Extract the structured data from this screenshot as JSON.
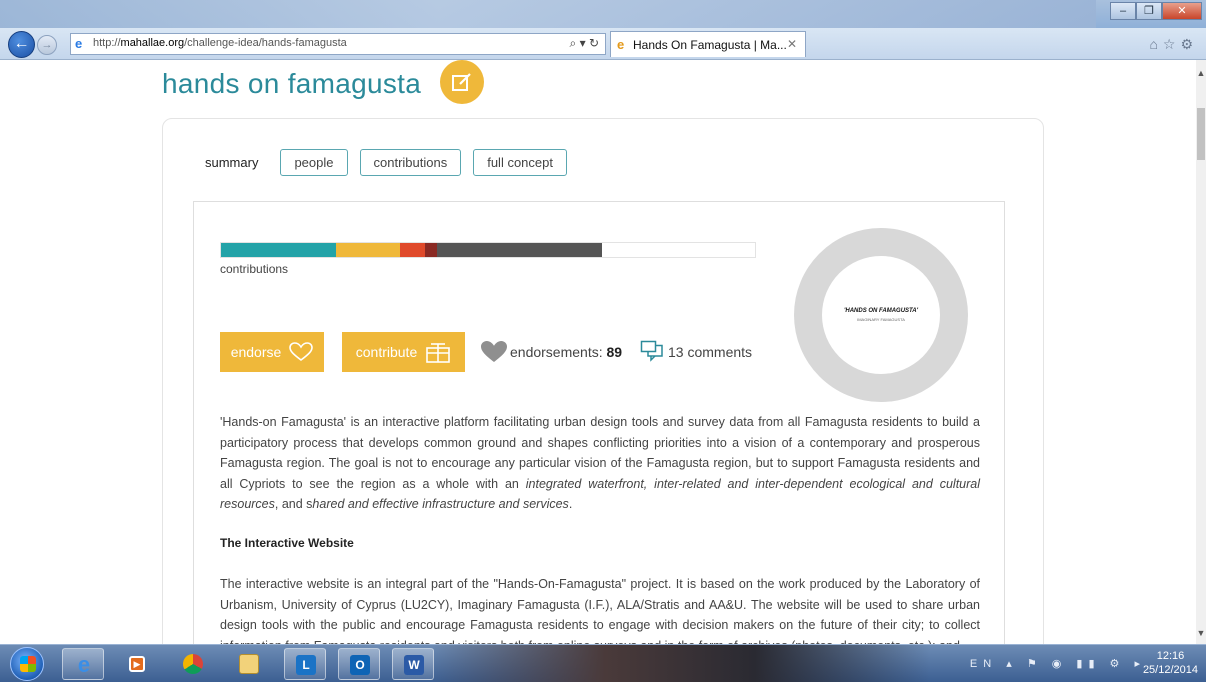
{
  "browser": {
    "url_prefix": "http://",
    "url_host": "mahallae.org",
    "url_path": "/challenge-idea/hands-famagusta",
    "tab_title": "Hands On Famagusta | Ma...",
    "address_icons": "⌕ ▾ ↻"
  },
  "page": {
    "title": "hands on famagusta",
    "tabs": {
      "summary": "summary",
      "people": "people",
      "contributions": "contributions",
      "full_concept": "full concept"
    },
    "progress": {
      "label": "contributions",
      "segments": [
        {
          "color": "#23a3a8",
          "share": 0.215
        },
        {
          "color": "#efb83a",
          "share": 0.12
        },
        {
          "color": "#e04a2b",
          "share": 0.047
        },
        {
          "color": "#8a2a24",
          "share": 0.022
        },
        {
          "color": "#555555",
          "share": 0.31
        },
        {
          "color": "#ffffff",
          "share": 0.286
        }
      ]
    },
    "actions": {
      "endorse": "endorse",
      "contribute": "contribute",
      "endorsements_label": "endorsements:",
      "endorsements_count": "89",
      "comments": "13 comments"
    },
    "logo": {
      "title": "'HANDS ON FAMAGUSTA'",
      "subtitle": "IMAGINARY FAMAGUSTA"
    },
    "intro": {
      "p1": "'Hands-on Famagusta' is an interactive platform facilitating urban design tools and survey data from all Famagusta residents to build a participatory process that develops common ground and shapes conflicting priorities into a vision of a contemporary and prosperous Famagusta region. The goal is not to encourage any particular vision of the Famagusta region, but to support Famagusta residents and all Cypriots to see the region as a whole with an ",
      "em1": "integrated waterfront, inter-related and inter-dependent ecological and cultural resources",
      "p2": ", and s",
      "em2": "hared and effective infrastructure and services",
      "p3": "."
    },
    "section_heading": "The Interactive Website",
    "section_text": "The interactive website is an integral part of the \"Hands-On-Famagusta\" project. It is based on the work produced by the Laboratory of Urbanism, University of Cyprus (LU2CY), Imaginary Famagusta (I.F.), ALA/Stratis and AA&U. The website will be used to share urban design tools with the public and encourage Famagusta residents to engage with decision makers on the future of their city; to collect information from Famagusta residents and visitors both from online surveys and in the form of archives (photos, documents, etc.); and"
  },
  "taskbar": {
    "tray": "EN ▴ ⚑ ◉ ▮▮ ⚙ ▸",
    "time": "12:16",
    "date": "25/12/2014"
  }
}
